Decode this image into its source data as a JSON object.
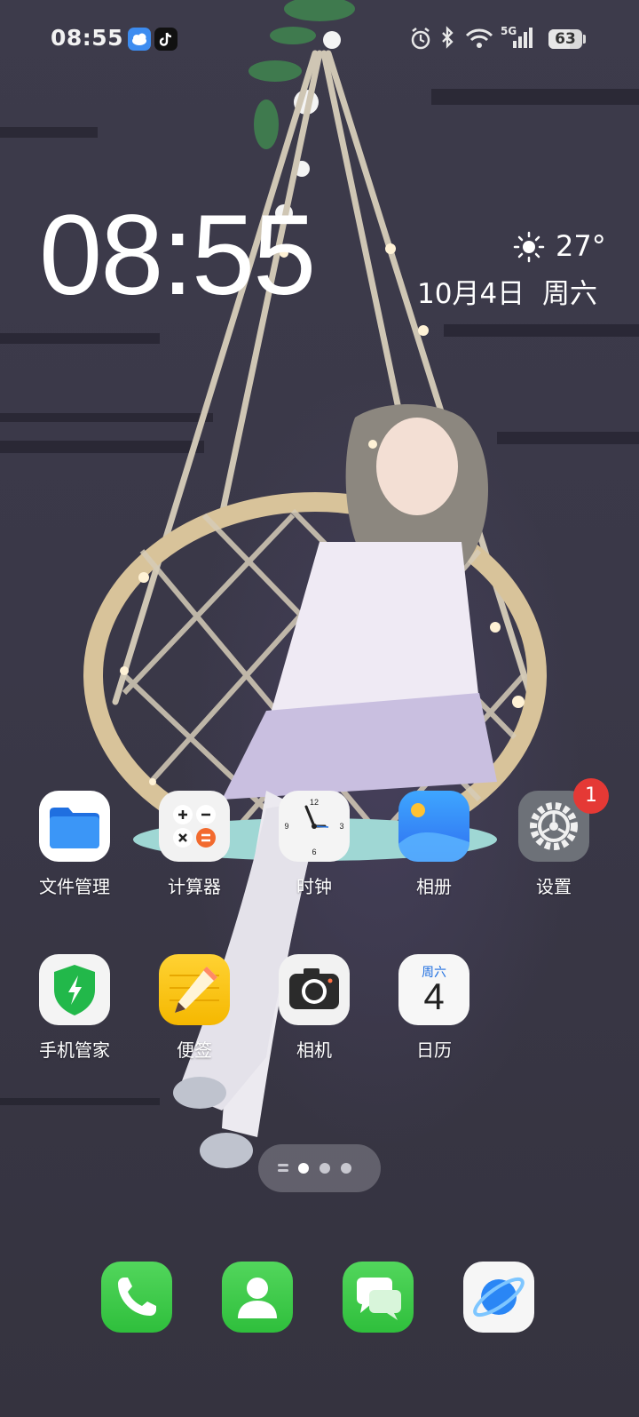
{
  "status_bar": {
    "time": "08:55",
    "battery_level": "63",
    "network": "5G",
    "notification_apps": [
      "weather-app",
      "tiktok-app"
    ]
  },
  "clock_widget": {
    "time": "08:55",
    "temperature": "27°",
    "date": "10月4日",
    "weekday": "周六"
  },
  "apps": {
    "row1": [
      {
        "label": "文件管理",
        "icon": "folder-icon"
      },
      {
        "label": "计算器",
        "icon": "calculator-icon"
      },
      {
        "label": "时钟",
        "icon": "clock-icon"
      },
      {
        "label": "相册",
        "icon": "gallery-icon"
      },
      {
        "label": "设置",
        "icon": "gear-icon",
        "badge": "1"
      }
    ],
    "row2": [
      {
        "label": "手机管家",
        "icon": "shield-icon"
      },
      {
        "label": "便签",
        "icon": "notepad-icon"
      },
      {
        "label": "相机",
        "icon": "camera-icon"
      },
      {
        "label": "日历",
        "icon": "calendar-icon",
        "calendar_weekday": "周六",
        "calendar_day": "4"
      }
    ]
  },
  "page_indicator": {
    "pages": 3,
    "current": 1
  },
  "dock": [
    {
      "icon": "phone-icon"
    },
    {
      "icon": "contacts-icon"
    },
    {
      "icon": "messages-icon"
    },
    {
      "icon": "browser-icon"
    }
  ],
  "colors": {
    "background": "#3a3848",
    "badge": "#e53935",
    "dock_green": "#3fc94a",
    "folder_blue": "#2f86f5"
  }
}
